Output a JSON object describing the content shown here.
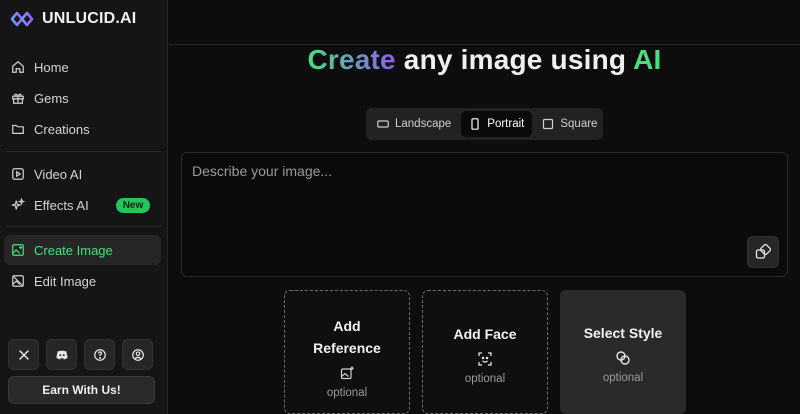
{
  "app": {
    "name": "UNLUCID.AI"
  },
  "sidebar": {
    "items": [
      {
        "label": "Home",
        "icon": "home-icon"
      },
      {
        "label": "Gems",
        "icon": "gift-icon"
      },
      {
        "label": "Creations",
        "icon": "folder-icon"
      },
      {
        "label": "Video AI",
        "icon": "video-icon"
      },
      {
        "label": "Effects AI",
        "icon": "sparkles-icon",
        "badge": "New"
      },
      {
        "label": "Create Image",
        "icon": "image-plus-icon",
        "active": true
      },
      {
        "label": "Edit Image",
        "icon": "image-edit-icon"
      }
    ],
    "social": [
      "x-icon",
      "discord-icon",
      "help-icon",
      "profile-icon"
    ],
    "earn_label": "Earn With Us!"
  },
  "main": {
    "title": {
      "part1": "Create",
      "part2": " any image using ",
      "part3": "AI"
    },
    "aspect": {
      "options": [
        "Landscape",
        "Portrait",
        "Square"
      ],
      "selected": "Portrait"
    },
    "prompt": {
      "placeholder": "Describe your image...",
      "value": ""
    },
    "cards": [
      {
        "title_line1": "Add",
        "title_line2": "Reference",
        "sub": "optional",
        "icon": "image-add-icon"
      },
      {
        "title": "Add Face",
        "sub": "optional",
        "icon": "face-scan-icon"
      },
      {
        "title": "Select Style",
        "sub": "optional",
        "icon": "style-circles-icon"
      }
    ]
  },
  "colors": {
    "accent_green": "#4ade80",
    "accent_purple": "#8b5cf6",
    "bg": "#0d0d0d",
    "sidebar_bg": "#151515"
  }
}
